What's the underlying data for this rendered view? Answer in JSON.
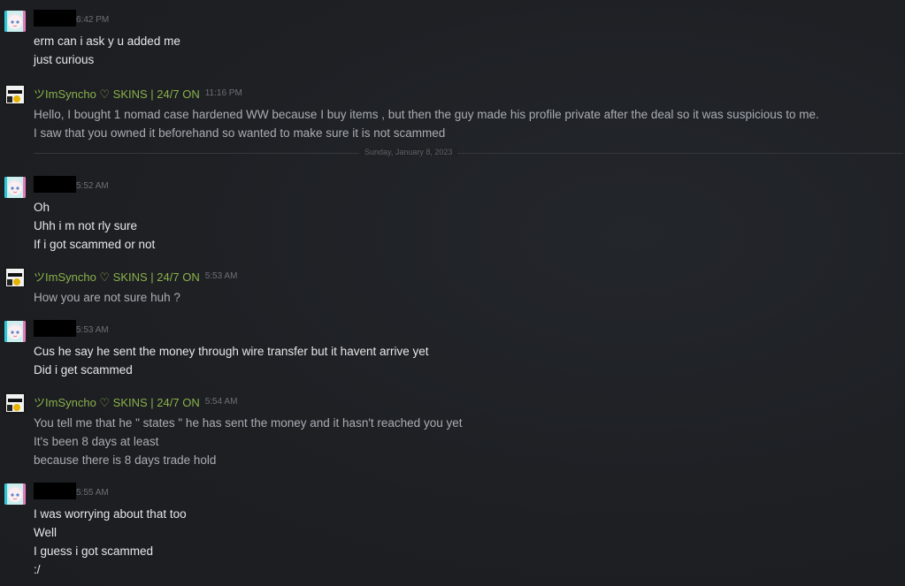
{
  "colors": {
    "background": "#1e2024",
    "self_name": "#8bb14a",
    "partner_text": "#e6e7e9",
    "self_text": "#a9adb3",
    "timestamp": "#6b6f75"
  },
  "self_name": "ツImSyncho ♡ SKINS | 24/7 ON",
  "divider_label": "Sunday, January 8, 2023",
  "messages": [
    {
      "sender": "partner",
      "time": "6:42 PM",
      "lines": [
        "erm can i ask y u added me",
        "just curious"
      ]
    },
    {
      "sender": "self",
      "time": "11:16 PM",
      "lines": [
        "Hello, I bought 1 nomad case hardened WW because I buy items , but then the guy made his profile private after the deal so it was suspicious to me.",
        "I saw that you owned it beforehand so wanted to make sure it is not scammed"
      ]
    },
    {
      "sender": "partner",
      "time": "5:52 AM",
      "lines": [
        "Oh",
        "Uhh i m not rly sure",
        "If i got scammed or not"
      ]
    },
    {
      "sender": "self",
      "time": "5:53 AM",
      "lines": [
        "How you are not sure huh ?"
      ]
    },
    {
      "sender": "partner",
      "time": "5:53 AM",
      "lines": [
        "Cus he say he sent the money through wire transfer but it havent arrive yet",
        "Did i get scammed"
      ]
    },
    {
      "sender": "self",
      "time": "5:54 AM",
      "lines": [
        "You tell me that he \" states \" he has sent the money and it hasn't reached you yet",
        "It's been 8 days at least",
        "because there is 8 days trade hold"
      ]
    },
    {
      "sender": "partner",
      "time": "5:55 AM",
      "lines": [
        "I was worrying about that too",
        "Well",
        "I guess i got scammed",
        ":/"
      ]
    }
  ]
}
